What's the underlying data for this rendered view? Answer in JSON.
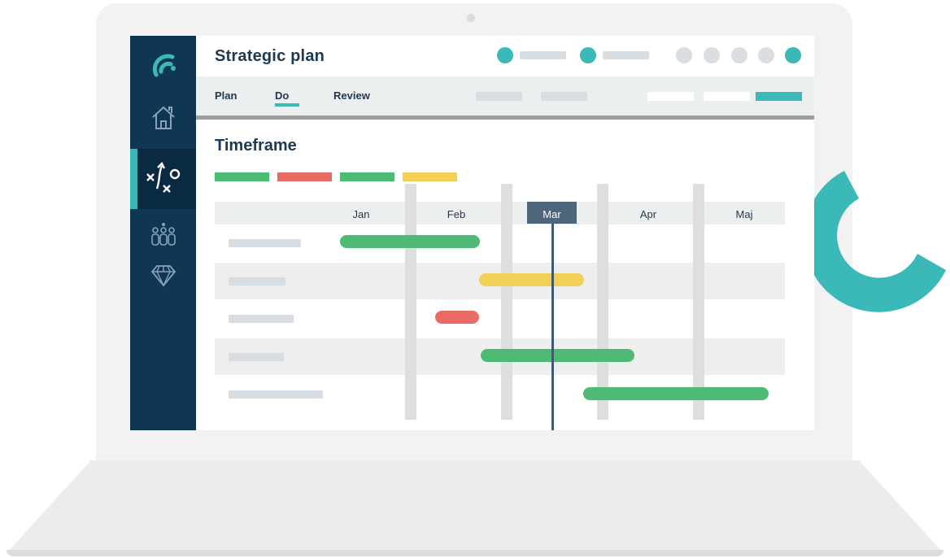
{
  "app": {
    "title": "Strategic plan",
    "tabs": [
      {
        "label": "Plan"
      },
      {
        "label": "Do"
      },
      {
        "label": "Review"
      }
    ],
    "active_tab": "Do"
  },
  "sidebar": {
    "items": [
      {
        "icon": "home-icon"
      },
      {
        "icon": "strategy-icon",
        "active": true
      },
      {
        "icon": "team-icon"
      },
      {
        "icon": "diamond-icon"
      }
    ]
  },
  "section": {
    "title": "Timeframe"
  },
  "timeline": {
    "months": [
      "Jan",
      "Feb",
      "Mar",
      "Apr",
      "Maj"
    ],
    "current_month": "Mar"
  },
  "colors": {
    "navy": "#0f3653",
    "teal": "#3bb8b8",
    "green": "#4dbb73",
    "red": "#ea6b65",
    "yellow": "#f2cf55",
    "dark_text": "#1d3a55"
  }
}
